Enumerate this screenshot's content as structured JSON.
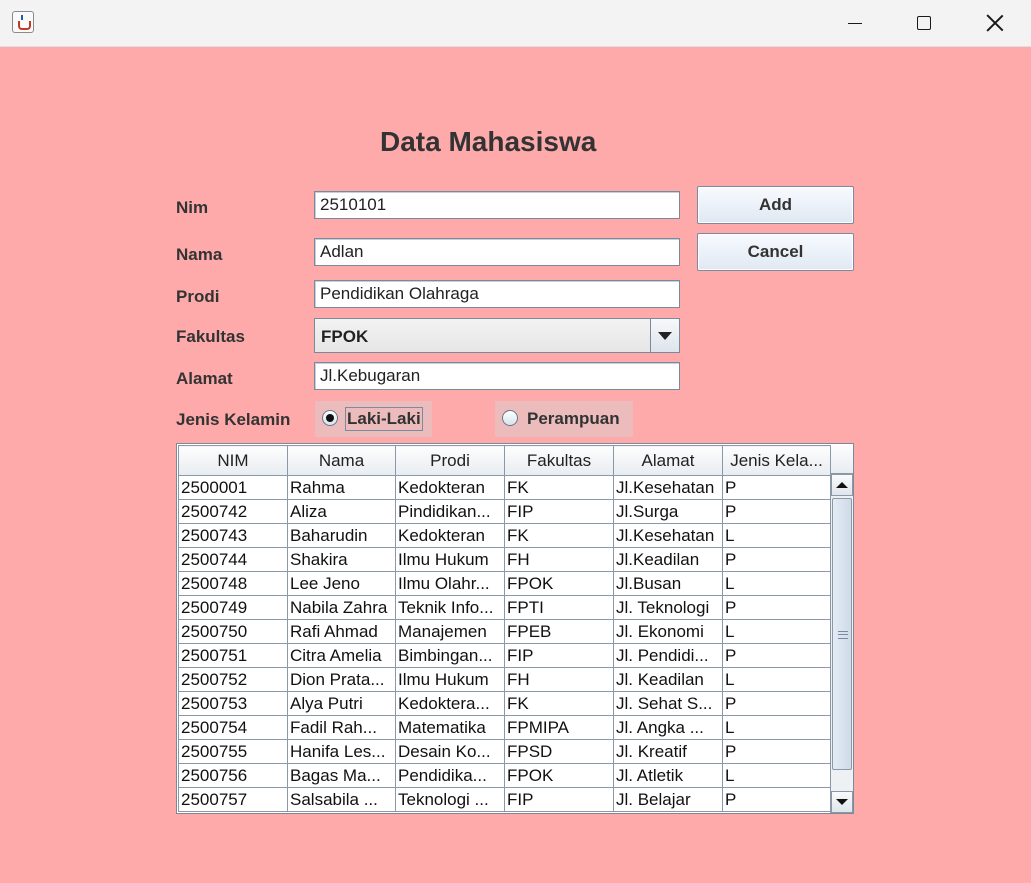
{
  "window": {
    "icon": "java-cup-icon",
    "controls": [
      "minimize-icon",
      "maximize-icon",
      "close-icon"
    ]
  },
  "form": {
    "title": "Data Mahasiswa",
    "nim_label": "Nim",
    "nim_value": "2510101",
    "nama_label": "Nama",
    "nama_value": "Adlan",
    "prodi_label": "Prodi",
    "prodi_value": "Pendidikan Olahraga",
    "fakultas_label": "Fakultas",
    "fakultas_value": "FPOK",
    "alamat_label": "Alamat",
    "alamat_value": "Jl.Kebugaran",
    "gender_label": "Jenis Kelamin",
    "gender_options": [
      "Laki-Laki",
      "Perampuan"
    ],
    "gender_selected": "Laki-Laki"
  },
  "buttons": {
    "add": "Add",
    "cancel": "Cancel"
  },
  "table": {
    "headers": [
      "NIM",
      "Nama",
      "Prodi",
      "Fakultas",
      "Alamat",
      "Jenis Kela..."
    ],
    "rows": [
      [
        "2500001",
        "Rahma",
        "Kedokteran",
        "FK",
        "Jl.Kesehatan",
        "P"
      ],
      [
        "2500742",
        "Aliza",
        "Pindidikan...",
        "FIP",
        "Jl.Surga",
        "P"
      ],
      [
        "2500743",
        "Baharudin",
        "Kedokteran",
        "FK",
        "Jl.Kesehatan",
        "L"
      ],
      [
        "2500744",
        "Shakira",
        "Ilmu Hukum",
        "FH",
        "Jl.Keadilan",
        "P"
      ],
      [
        "2500748",
        "Lee Jeno",
        "Ilmu Olahr...",
        "FPOK",
        "Jl.Busan",
        "L"
      ],
      [
        "2500749",
        "Nabila Zahra",
        "Teknik Info...",
        "FPTI",
        "Jl. Teknologi",
        "P"
      ],
      [
        "2500750",
        "Rafi Ahmad",
        "Manajemen",
        "FPEB",
        "Jl. Ekonomi",
        "L"
      ],
      [
        "2500751",
        "Citra Amelia",
        "Bimbingan...",
        "FIP",
        "Jl. Pendidi...",
        "P"
      ],
      [
        "2500752",
        "Dion Prata...",
        "Ilmu Hukum",
        "FH",
        "Jl. Keadilan",
        "L"
      ],
      [
        "2500753",
        "Alya Putri",
        "Kedoktera...",
        "FK",
        "Jl. Sehat S...",
        "P"
      ],
      [
        "2500754",
        "Fadil Rah...",
        "Matematika",
        "FPMIPA",
        "Jl. Angka ...",
        "L"
      ],
      [
        "2500755",
        "Hanifa Les...",
        "Desain Ko...",
        "FPSD",
        "Jl. Kreatif",
        "P"
      ],
      [
        "2500756",
        "Bagas Ma...",
        "Pendidika...",
        "FPOK",
        "Jl. Atletik",
        "L"
      ],
      [
        "2500757",
        "Salsabila ...",
        "Teknologi ...",
        "FIP",
        "Jl. Belajar",
        "P"
      ]
    ]
  },
  "colors": {
    "background": "#ffaaaa",
    "titlebar": "#f3f3f3",
    "radio_bg": "#ecbcbc"
  }
}
